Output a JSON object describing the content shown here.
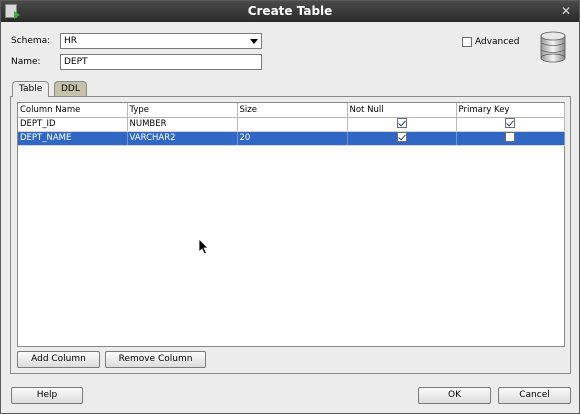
{
  "window": {
    "title": "Create Table"
  },
  "icons": {
    "app": "app-icon",
    "close": "close-icon",
    "database": "database-icon",
    "cursor": "mouse-cursor-icon"
  },
  "form": {
    "schema_label": "Schema:",
    "schema_value": "HR",
    "name_label": "Name:",
    "name_value": "DEPT",
    "advanced_label": "Advanced",
    "advanced_checked": false
  },
  "tabs": [
    {
      "label": "Table",
      "active": true
    },
    {
      "label": "DDL",
      "active": false
    }
  ],
  "table": {
    "headers": [
      "Column Name",
      "Type",
      "Size",
      "Not Null",
      "Primary Key"
    ],
    "rows": [
      {
        "name": "DEPT_ID",
        "type": "NUMBER",
        "size": "",
        "not_null": true,
        "primary_key": true,
        "selected": false
      },
      {
        "name": "DEPT_NAME",
        "type": "VARCHAR2",
        "size": "20",
        "not_null": true,
        "primary_key": false,
        "selected": true
      }
    ]
  },
  "buttons": {
    "add_column": "Add Column",
    "remove_column": "Remove Column",
    "help": "Help",
    "ok": "OK",
    "cancel": "Cancel"
  },
  "colors": {
    "titlebar": "#2f2f2f",
    "selection": "#3167c4",
    "inactive_tab": "#c4c2a8"
  }
}
